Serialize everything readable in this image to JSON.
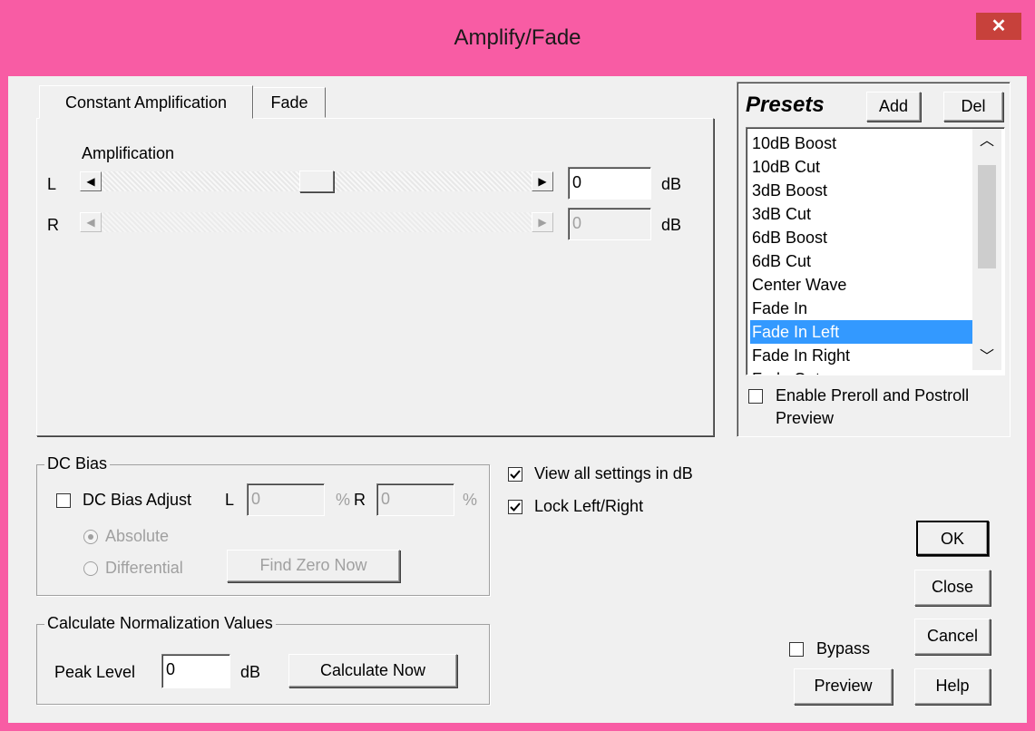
{
  "window": {
    "title": "Amplify/Fade",
    "close_glyph": "✕"
  },
  "tabs": [
    {
      "label": "Constant Amplification"
    },
    {
      "label": "Fade"
    }
  ],
  "amplification": {
    "heading": "Amplification",
    "left": {
      "channel": "L",
      "value": "0",
      "unit": "dB",
      "slider_fraction": 0.5
    },
    "right": {
      "channel": "R",
      "value": "0",
      "unit": "dB"
    }
  },
  "presets": {
    "title": "Presets",
    "add_label": "Add",
    "del_label": "Del",
    "items": [
      "10dB Boost",
      "10dB Cut",
      "3dB Boost",
      "3dB Cut",
      "6dB Boost",
      "6dB Cut",
      "Center Wave",
      "Fade In",
      "Fade In Left",
      "Fade In Right",
      "Fade Out"
    ],
    "selected": "Fade In Left",
    "preroll_label_1": "Enable Preroll and Postroll",
    "preroll_label_2": "Preview",
    "preroll_checked": false
  },
  "dc_bias": {
    "group_label": "DC Bias",
    "adjust_label": "DC Bias Adjust",
    "adjust_checked": false,
    "l_label": "L",
    "l_value": "0",
    "r_label": "R",
    "r_value": "0",
    "pct": "%",
    "absolute_label": "Absolute",
    "differential_label": "Differential",
    "find_zero_label": "Find Zero Now"
  },
  "options": {
    "view_db_label": "View all settings in dB",
    "view_db_checked": true,
    "lock_label": "Lock Left/Right",
    "lock_checked": true
  },
  "normalization": {
    "group_label": "Calculate Normalization Values",
    "peak_label": "Peak Level",
    "peak_value": "0",
    "unit": "dB",
    "calculate_label": "Calculate Now"
  },
  "buttons": {
    "ok": "OK",
    "close": "Close",
    "cancel": "Cancel",
    "help": "Help",
    "preview": "Preview",
    "bypass_label": "Bypass",
    "bypass_checked": false
  },
  "colors": {
    "title_bar": "#f85ca4",
    "close_button": "#c7413b",
    "selection": "#3399ff"
  }
}
